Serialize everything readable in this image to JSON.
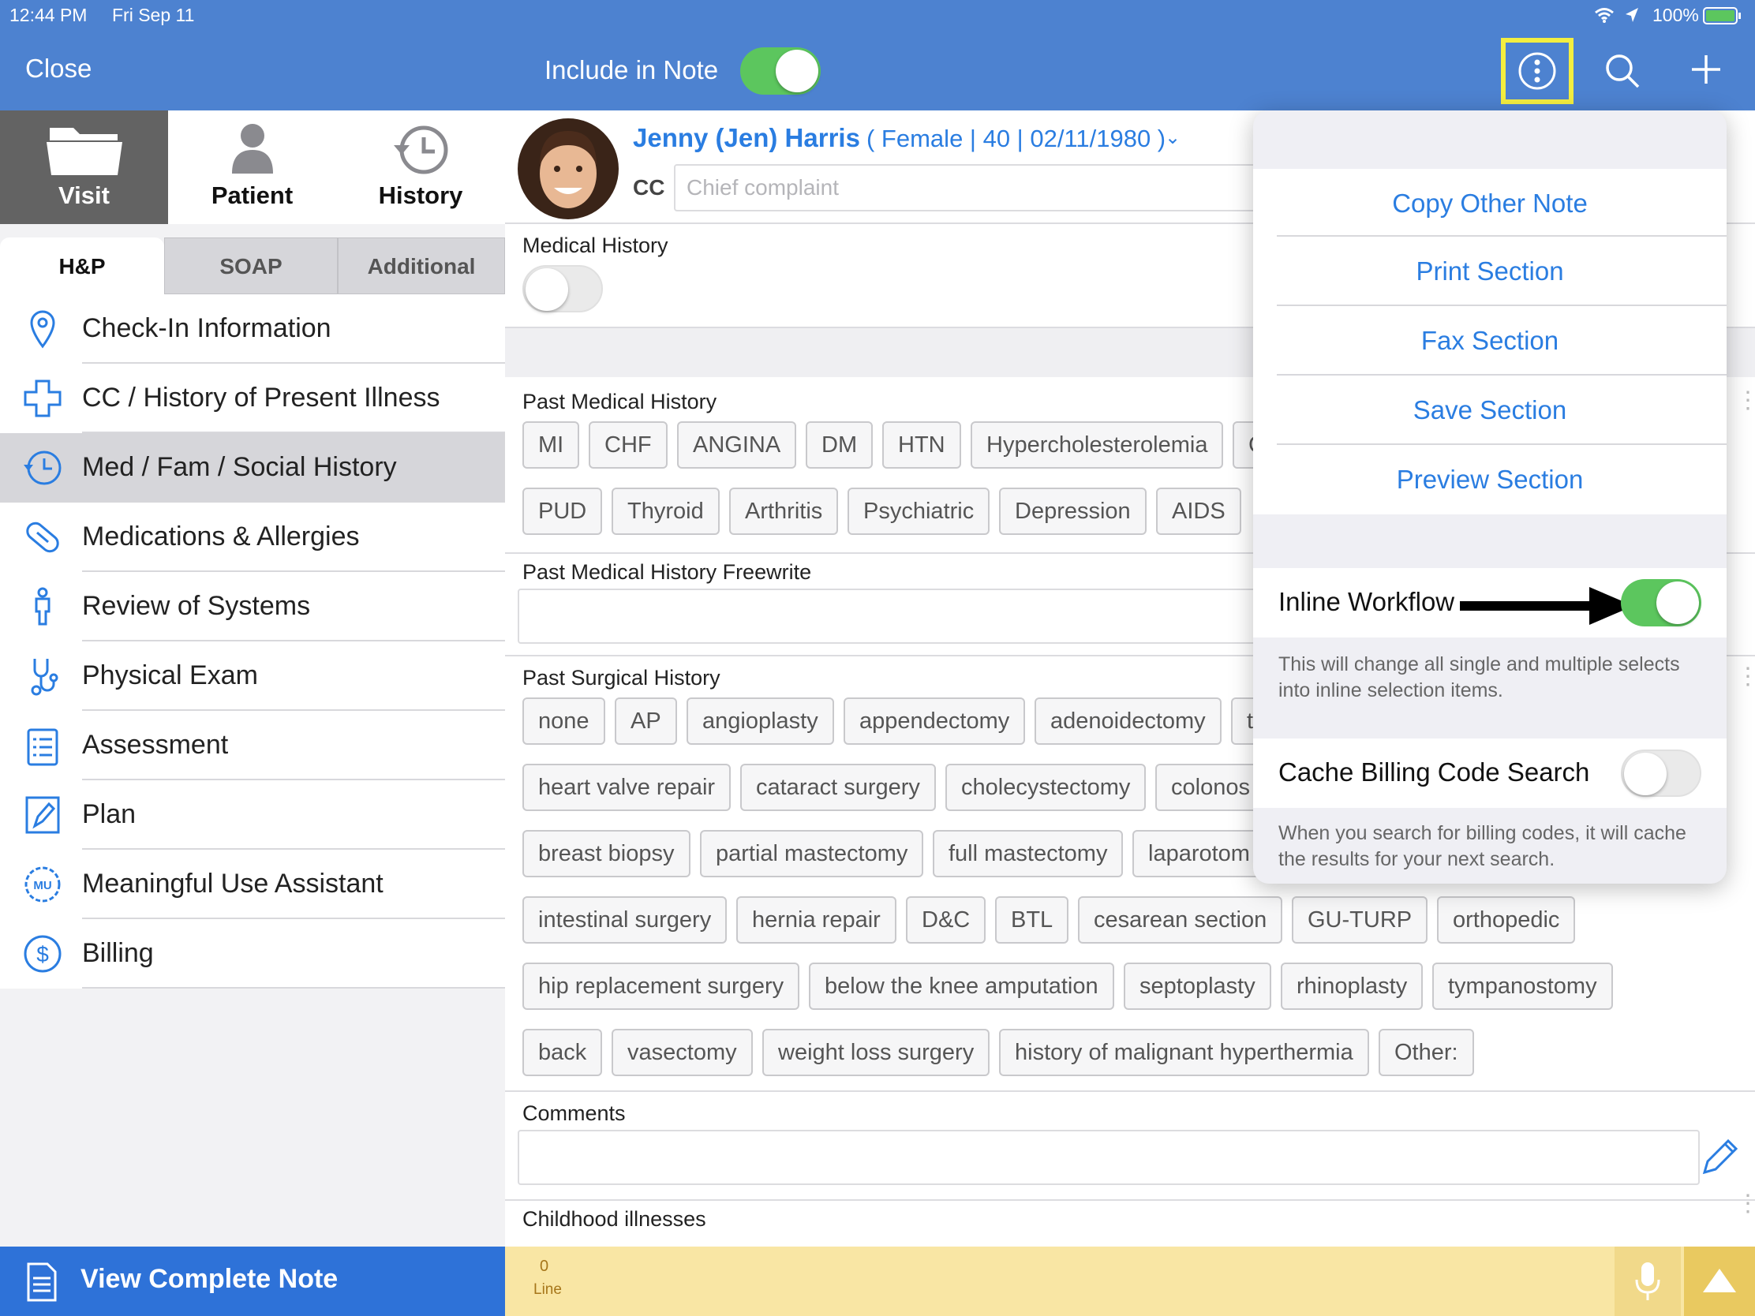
{
  "status_bar": {
    "time": "12:44 PM",
    "date": "Fri Sep 11",
    "battery": "100%"
  },
  "left_header": {
    "close_label": "Close"
  },
  "main_tabs": [
    {
      "label": "Visit",
      "icon": "folder-icon"
    },
    {
      "label": "Patient",
      "icon": "person-icon"
    },
    {
      "label": "History",
      "icon": "history-clock-icon"
    }
  ],
  "sub_tabs": [
    {
      "label": "H&P"
    },
    {
      "label": "SOAP"
    },
    {
      "label": "Additional"
    }
  ],
  "menu": [
    {
      "label": "Check-In Information",
      "icon": "location-pin-icon"
    },
    {
      "label": "CC / History of Present Illness",
      "icon": "medical-cross-icon"
    },
    {
      "label": "Med / Fam / Social History",
      "icon": "clock-history-icon"
    },
    {
      "label": "Medications & Allergies",
      "icon": "pill-icon"
    },
    {
      "label": "Review of Systems",
      "icon": "body-icon"
    },
    {
      "label": "Physical Exam",
      "icon": "stethoscope-icon"
    },
    {
      "label": "Assessment",
      "icon": "clipboard-icon"
    },
    {
      "label": "Plan",
      "icon": "pen-icon"
    },
    {
      "label": "Meaningful Use Assistant",
      "icon": "mu-badge-icon"
    },
    {
      "label": "Billing",
      "icon": "dollar-icon"
    }
  ],
  "view_note_label": "View Complete Note",
  "right_header": {
    "include_label": "Include in Note",
    "include_on": true
  },
  "patient": {
    "name": "Jenny (Jen) Harris",
    "details": "( Female | 40 | 02/11/1980 )",
    "cc_label": "CC",
    "cc_placeholder": "Chief complaint"
  },
  "sections": {
    "medical_history": "Medical History",
    "past_medical_history": "Past Medical History",
    "pmh_freewrite": "Past Medical History Freewrite",
    "past_surgical_history": "Past Surgical History",
    "comments": "Comments",
    "childhood_illnesses": "Childhood illnesses"
  },
  "pmh_chips": [
    [
      "MI",
      "CHF",
      "ANGINA",
      "DM",
      "HTN",
      "Hypercholesterolemia",
      "CV"
    ],
    [
      "PUD",
      "Thyroid",
      "Arthritis",
      "Psychiatric",
      "Depression",
      "AIDS"
    ]
  ],
  "psh_chips": [
    [
      "none",
      "AP",
      "angioplasty",
      "appendectomy",
      "adenoidectomy",
      "to"
    ],
    [
      "heart valve repair",
      "cataract surgery",
      "cholecystectomy",
      "colonos"
    ],
    [
      "breast biopsy",
      "partial mastectomy",
      "full mastectomy",
      "laparotom"
    ],
    [
      "intestinal surgery",
      "hernia repair",
      "D&C",
      "BTL",
      "cesarean section",
      "GU-TURP",
      "orthopedic"
    ],
    [
      "hip replacement surgery",
      "below the knee amputation",
      "septoplasty",
      "rhinoplasty",
      "tympanostomy"
    ],
    [
      "back",
      "vasectomy",
      "weight loss surgery",
      "history of malignant hyperthermia",
      "Other:"
    ]
  ],
  "bottom_bar": {
    "count": "0",
    "unit": "Line"
  },
  "popover": {
    "items": [
      "Copy Other Note",
      "Print Section",
      "Fax Section",
      "Save Section",
      "Preview Section"
    ],
    "inline_workflow": {
      "label": "Inline Workflow",
      "on": true,
      "description": "This will change all single and multiple selects into inline selection items."
    },
    "cache_billing": {
      "label": "Cache Billing Code Search",
      "on": false,
      "description": "When you search for billing codes, it will cache the results for your next search."
    }
  },
  "colors": {
    "header_blue": "#4d82d0",
    "accent_blue": "#2a7de1",
    "toggle_green": "#5cc65e",
    "highlight_yellow": "#f3ee40",
    "bottom_yellow": "#f9e6a4"
  }
}
